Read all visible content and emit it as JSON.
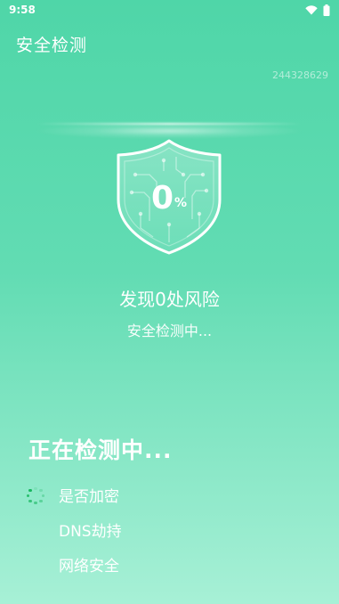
{
  "status_bar": {
    "time": "9:58",
    "icons": [
      "wifi-icon",
      "battery-icon"
    ]
  },
  "header": {
    "title": "安全检测",
    "device_id": "244328629"
  },
  "scan": {
    "progress_value": "0",
    "progress_unit": "%",
    "risk_text": "发现0处风险",
    "status_text": "安全检测中..."
  },
  "detecting": {
    "title": "正在检测中...",
    "items": [
      {
        "label": "是否加密",
        "state": "loading"
      },
      {
        "label": "DNS劫持",
        "state": "pending"
      },
      {
        "label": "网络安全",
        "state": "pending"
      }
    ]
  },
  "colors": {
    "background_top": "#4fd6a8",
    "background_bottom": "#a7f0d6",
    "spinner": "#19b860"
  }
}
